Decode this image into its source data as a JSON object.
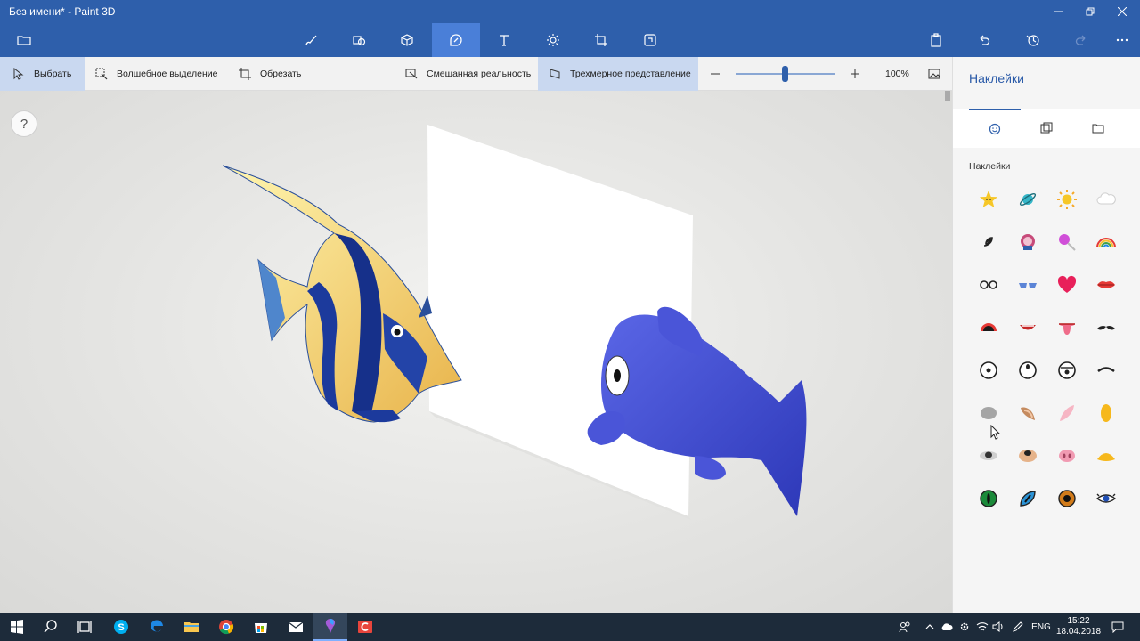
{
  "window": {
    "title": "Без имени* - Paint 3D",
    "minimize_icon": "minimize-icon",
    "maximize_icon": "restore-icon",
    "close_icon": "close-icon"
  },
  "toolbar": {
    "menu_icon": "folder-icon",
    "tools": [
      "brush-icon",
      "2d-shapes-icon",
      "3d-shapes-icon",
      "stickers-icon",
      "text-icon",
      "effects-icon",
      "canvas-icon",
      "3d-library-icon"
    ],
    "active_tool": "stickers-icon",
    "right": [
      "paste-icon",
      "undo-icon",
      "history-icon",
      "redo-icon",
      "more-icon"
    ]
  },
  "subbar": {
    "select_label": "Выбрать",
    "magic_select_label": "Волшебное выделение",
    "crop_label": "Обрезать",
    "mixed_reality_label": "Смешанная реальность",
    "view_3d_label": "Трехмерное представление",
    "zoom": 100,
    "zoom_label": "100%"
  },
  "canvas": {
    "help_label": "?"
  },
  "panel": {
    "title": "Наклейки",
    "tabs": [
      "stickers-tab-icon",
      "textures-tab-icon",
      "custom-sticker-icon"
    ],
    "section_label": "Наклейки",
    "stickers": [
      "star-sticker",
      "planet-sticker",
      "sun-sticker",
      "cloud-sticker",
      "spiral-sticker",
      "ribbon-sticker",
      "lollipop-sticker",
      "rainbow-sticker",
      "glasses-sticker",
      "sunglasses-sticker",
      "heart-sticker",
      "lips-sticker",
      "open-mouth-sticker",
      "smiling-mouth-sticker",
      "tongue-sticker",
      "mustache-sticker",
      "round-eye-sticker",
      "big-eye-sticker",
      "sleepy-eye-sticker",
      "eyebrow-sticker",
      "gray-nose-sticker",
      "bunny-ear-sticker",
      "pink-ear-sticker",
      "yellow-ear-sticker",
      "koala-nose-sticker",
      "dog-nose-sticker",
      "pig-nose-sticker",
      "duck-beak-sticker",
      "green-eye-sticker",
      "blue-cat-eye-sticker",
      "orange-eye-sticker",
      "lash-eye-sticker"
    ]
  },
  "taskbar": {
    "apps": [
      "windows-icon",
      "search-icon",
      "task-view-icon",
      "skype-icon",
      "edge-icon",
      "explorer-icon",
      "chrome-icon",
      "store-icon",
      "mail-icon",
      "paint3d-icon",
      "record-icon"
    ],
    "active_app": "paint3d-icon",
    "tray": {
      "lang": "ENG",
      "time": "15:22",
      "date": "18.04.2018"
    }
  },
  "colors": {
    "accent": "#2e5fab",
    "active_tool": "#4a7fd8",
    "panel_accent": "#2a5aa8",
    "taskbar": "#1d2b3a"
  }
}
